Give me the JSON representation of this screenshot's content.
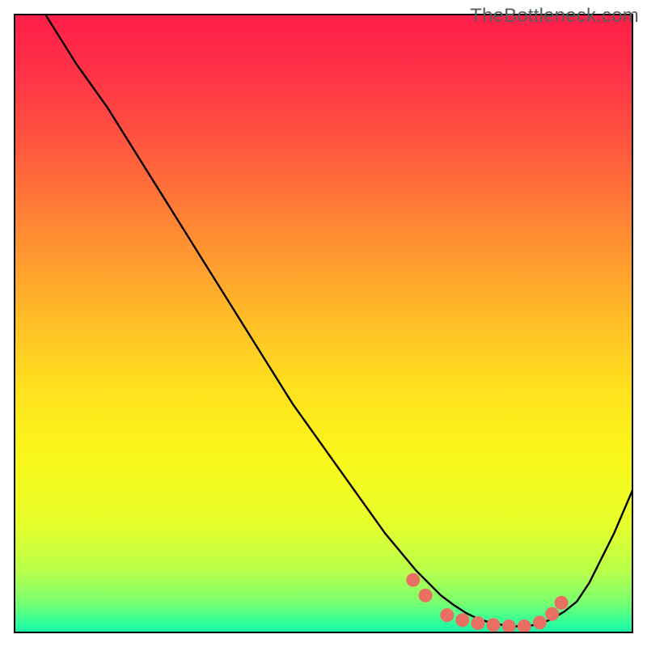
{
  "watermark": "TheBottleneck.com",
  "chart_data": {
    "type": "line",
    "title": "",
    "xlabel": "",
    "ylabel": "",
    "xlim": [
      0,
      100
    ],
    "ylim": [
      0,
      100
    ],
    "series": [
      {
        "name": "curve",
        "x": [
          0,
          5,
          10,
          15,
          20,
          25,
          30,
          35,
          40,
          45,
          50,
          55,
          60,
          65,
          67,
          69,
          71,
          73,
          75,
          77,
          79,
          81,
          83,
          85,
          87,
          89,
          91,
          93,
          95,
          97,
          100
        ],
        "y": [
          108,
          100,
          92,
          85,
          77,
          69,
          61,
          53,
          45,
          37,
          30,
          23,
          16,
          10,
          8,
          6,
          4.5,
          3.2,
          2.2,
          1.6,
          1.2,
          1.0,
          1.0,
          1.4,
          2.2,
          3.4,
          5,
          8,
          12,
          16,
          23
        ]
      }
    ],
    "markers": {
      "name": "trough-points",
      "x": [
        64.5,
        66.5,
        70,
        72.5,
        75,
        77.5,
        80,
        82.5,
        85,
        87,
        88.5
      ],
      "y": [
        8.5,
        6.0,
        2.8,
        2.0,
        1.5,
        1.2,
        1.0,
        1.0,
        1.6,
        3.0,
        4.8
      ]
    },
    "gradient_stops": [
      {
        "offset": 0.0,
        "color": "#ff1e49"
      },
      {
        "offset": 0.1,
        "color": "#ff3347"
      },
      {
        "offset": 0.22,
        "color": "#ff5a3e"
      },
      {
        "offset": 0.35,
        "color": "#ff8a33"
      },
      {
        "offset": 0.48,
        "color": "#ffb828"
      },
      {
        "offset": 0.6,
        "color": "#ffe01e"
      },
      {
        "offset": 0.72,
        "color": "#faf81a"
      },
      {
        "offset": 0.82,
        "color": "#e8ff2a"
      },
      {
        "offset": 0.9,
        "color": "#b9ff4a"
      },
      {
        "offset": 0.95,
        "color": "#7cff6e"
      },
      {
        "offset": 0.985,
        "color": "#2fff9a"
      },
      {
        "offset": 1.0,
        "color": "#16f0a8"
      }
    ],
    "frame": {
      "stroke": "#000000",
      "width": 2
    },
    "line_style": {
      "stroke": "#000000",
      "width": 2.4
    },
    "marker_style": {
      "fill": "#e96f63",
      "stroke": "#e96f63",
      "r": 8
    }
  }
}
